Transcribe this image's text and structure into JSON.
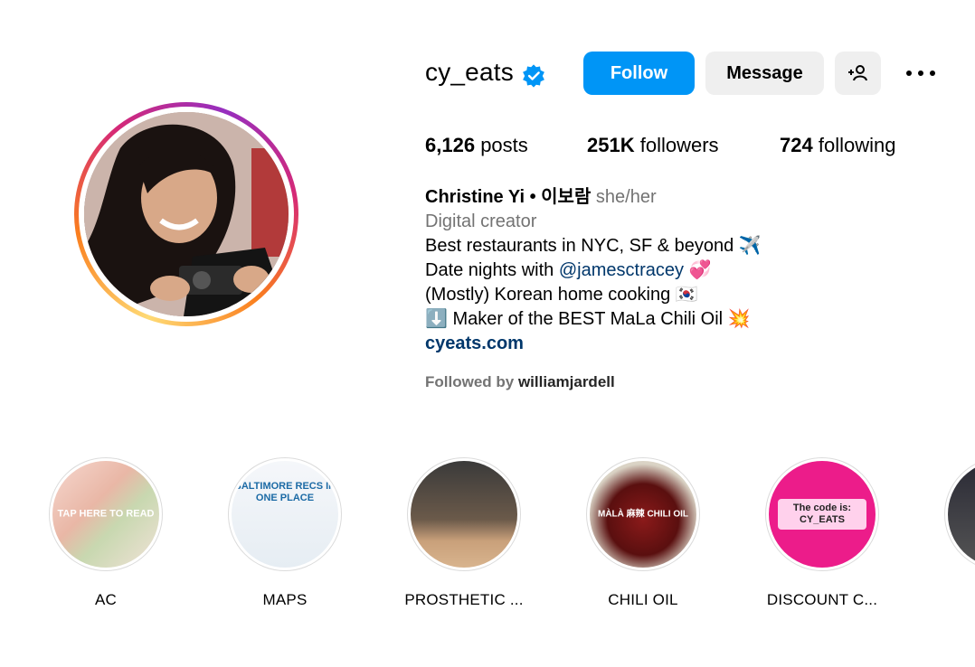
{
  "profile": {
    "username": "cy_eats",
    "follow_label": "Follow",
    "message_label": "Message",
    "stats": {
      "posts_count": "6,126",
      "posts_label": "posts",
      "followers_count": "251K",
      "followers_label": "followers",
      "following_count": "724",
      "following_label": "following"
    },
    "bio": {
      "name": "Christine Yi • 이보람",
      "pronouns": "she/her",
      "category": "Digital creator",
      "line1": "Best restaurants in NYC, SF & beyond ✈️",
      "line2_prefix": "Date nights with ",
      "line2_mention": "@jamesctracey",
      "line2_suffix": " 💞",
      "line3": "(Mostly) Korean home cooking 🇰🇷",
      "line4": "⬇️ Maker of the BEST MaLa Chili Oil 💥",
      "website": "cyeats.com"
    },
    "followed_by_label": "Followed by ",
    "followed_by_user": "williamjardell"
  },
  "highlights": [
    {
      "label": "AC",
      "overlay": "TAP HERE TO READ"
    },
    {
      "label": "MAPS",
      "overlay": "BALTIMORE RECS IN ONE PLACE"
    },
    {
      "label": "PROSTHETIC ...",
      "overlay": ""
    },
    {
      "label": "CHILI OIL",
      "overlay": "MÀLÀ 麻辣 CHILI OIL"
    },
    {
      "label": "DISCOUNT C...",
      "overlay": "The code is: CY_EATS"
    }
  ],
  "colors": {
    "follow_button": "#0095f6",
    "secondary_button": "#efefef",
    "verified_badge": "#0095f6",
    "link": "#00376b",
    "muted_text": "#737373"
  },
  "icons": [
    "verified-badge-icon",
    "add-user-icon",
    "more-options-icon"
  ]
}
